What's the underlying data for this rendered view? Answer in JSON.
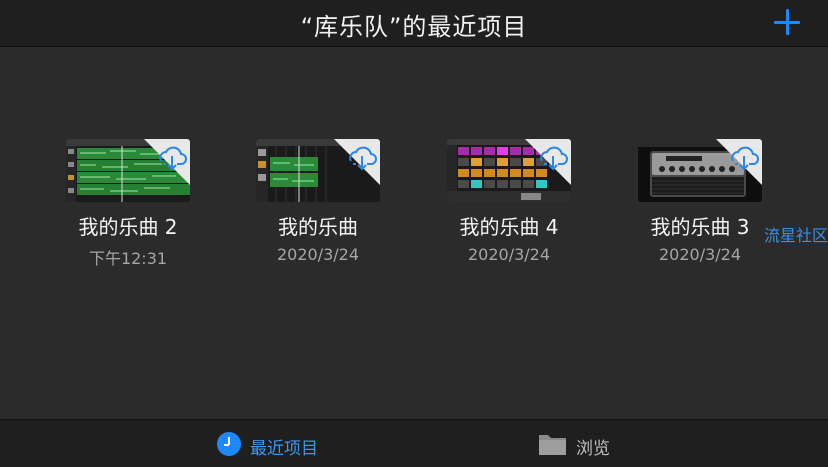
{
  "header": {
    "title": "“库乐队”的最近项目"
  },
  "projects": [
    {
      "name": "我的乐曲 2",
      "date": "下午12:31",
      "thumb": "tracks-green"
    },
    {
      "name": "我的乐曲",
      "date": "2020/3/24",
      "thumb": "tracks-sparse"
    },
    {
      "name": "我的乐曲 4",
      "date": "2020/3/24",
      "thumb": "live-loops"
    },
    {
      "name": "我的乐曲 3",
      "date": "2020/3/24",
      "thumb": "guitar-amp"
    }
  ],
  "watermark": "流星社区",
  "tabs": [
    {
      "label": "最近项目",
      "icon": "clock-icon",
      "active": true
    },
    {
      "label": "浏览",
      "icon": "folder-icon",
      "active": false
    }
  ],
  "colors": {
    "accent": "#1e88ff",
    "background": "#2b2b2b",
    "bar": "#1f1f1f"
  }
}
